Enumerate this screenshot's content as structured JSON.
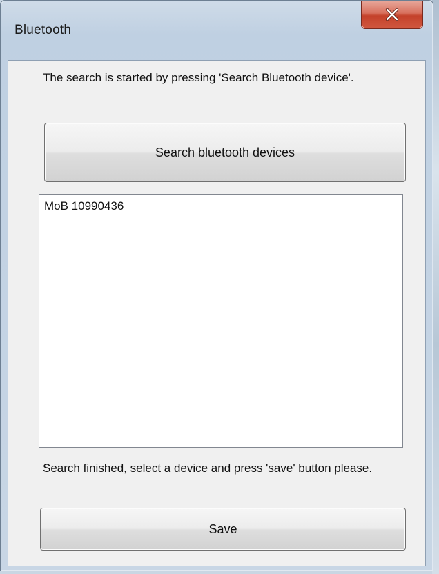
{
  "window": {
    "title": "Bluetooth",
    "close_icon": "close-x-icon",
    "close_color": "#c4412a"
  },
  "content": {
    "instruction": "The search is started by pressing 'Search Bluetooth device'.",
    "search_button_label": "Search bluetooth devices",
    "devices": [
      {
        "label": "MoB 10990436"
      }
    ],
    "status": "Search finished, select a device and press 'save' button please.",
    "save_button_label": "Save"
  }
}
